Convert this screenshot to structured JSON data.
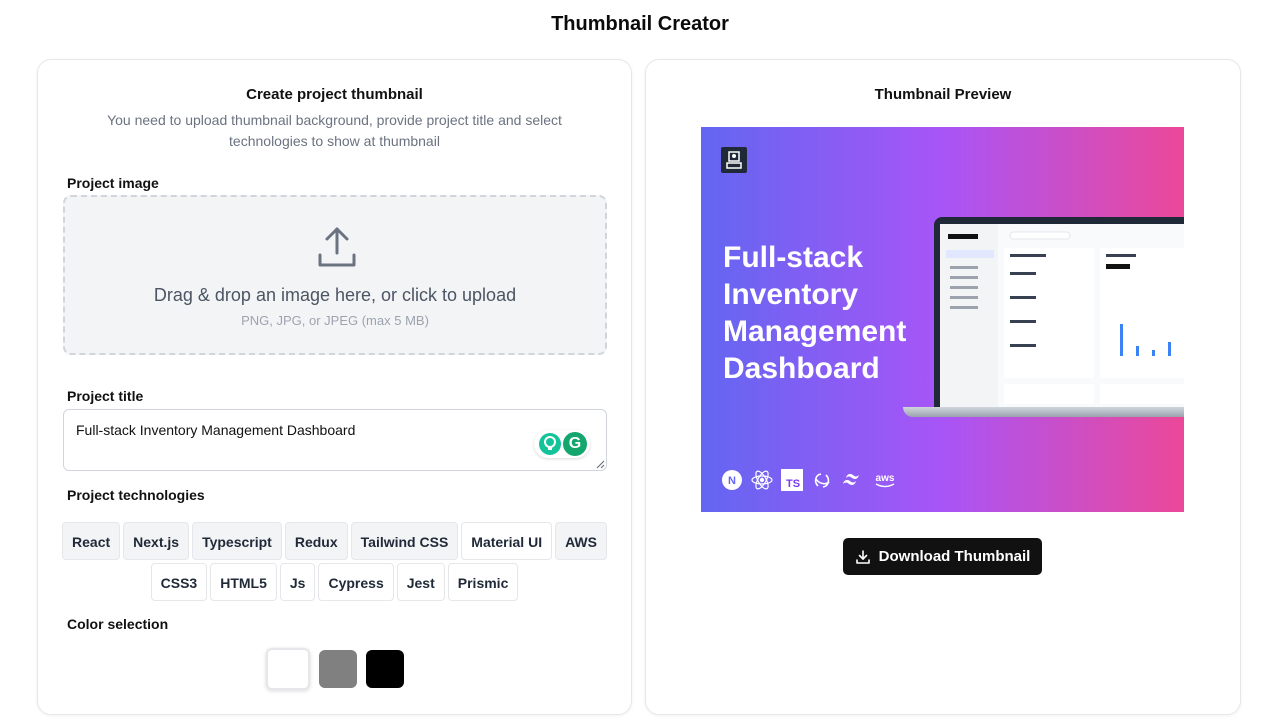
{
  "page": {
    "title": "Thumbnail Creator"
  },
  "form": {
    "heading": "Create project thumbnail",
    "description": "You need to upload thumbnail background, provide project title and select technologies to show at thumbnail",
    "image_label": "Project image",
    "dropzone": {
      "main_text": "Drag & drop an image here, or click to upload",
      "sub_text": "PNG, JPG, or JPEG (max 5 MB)",
      "icon": "upload-icon"
    },
    "title_label": "Project title",
    "title_value": "Full-stack Inventory Management Dashboard",
    "technologies_label": "Project technologies",
    "technologies_row1": [
      "React",
      "Next.js",
      "Typescript",
      "Redux",
      "Tailwind CSS",
      "Material UI",
      "AWS"
    ],
    "technologies_row2": [
      "CSS3",
      "HTML5",
      "Js",
      "Cypress",
      "Jest",
      "Prismic"
    ],
    "color_label": "Color selection",
    "colors": [
      "#ffffff",
      "#808080",
      "#000000"
    ],
    "selected_color": "#ffffff"
  },
  "preview": {
    "heading": "Thumbnail Preview",
    "thumbnail_title": "Full-stack Inventory Management Dashboard",
    "gradient": [
      "#6366f1",
      "#a855f7",
      "#ec4899"
    ],
    "tech_icons": [
      "nextjs-icon",
      "react-icon",
      "typescript-icon",
      "redux-icon",
      "tailwind-icon",
      "aws-icon"
    ],
    "ts_badge": "TS",
    "aws_badge": "aws",
    "next_badge": "N",
    "download_label": "Download Thumbnail"
  }
}
